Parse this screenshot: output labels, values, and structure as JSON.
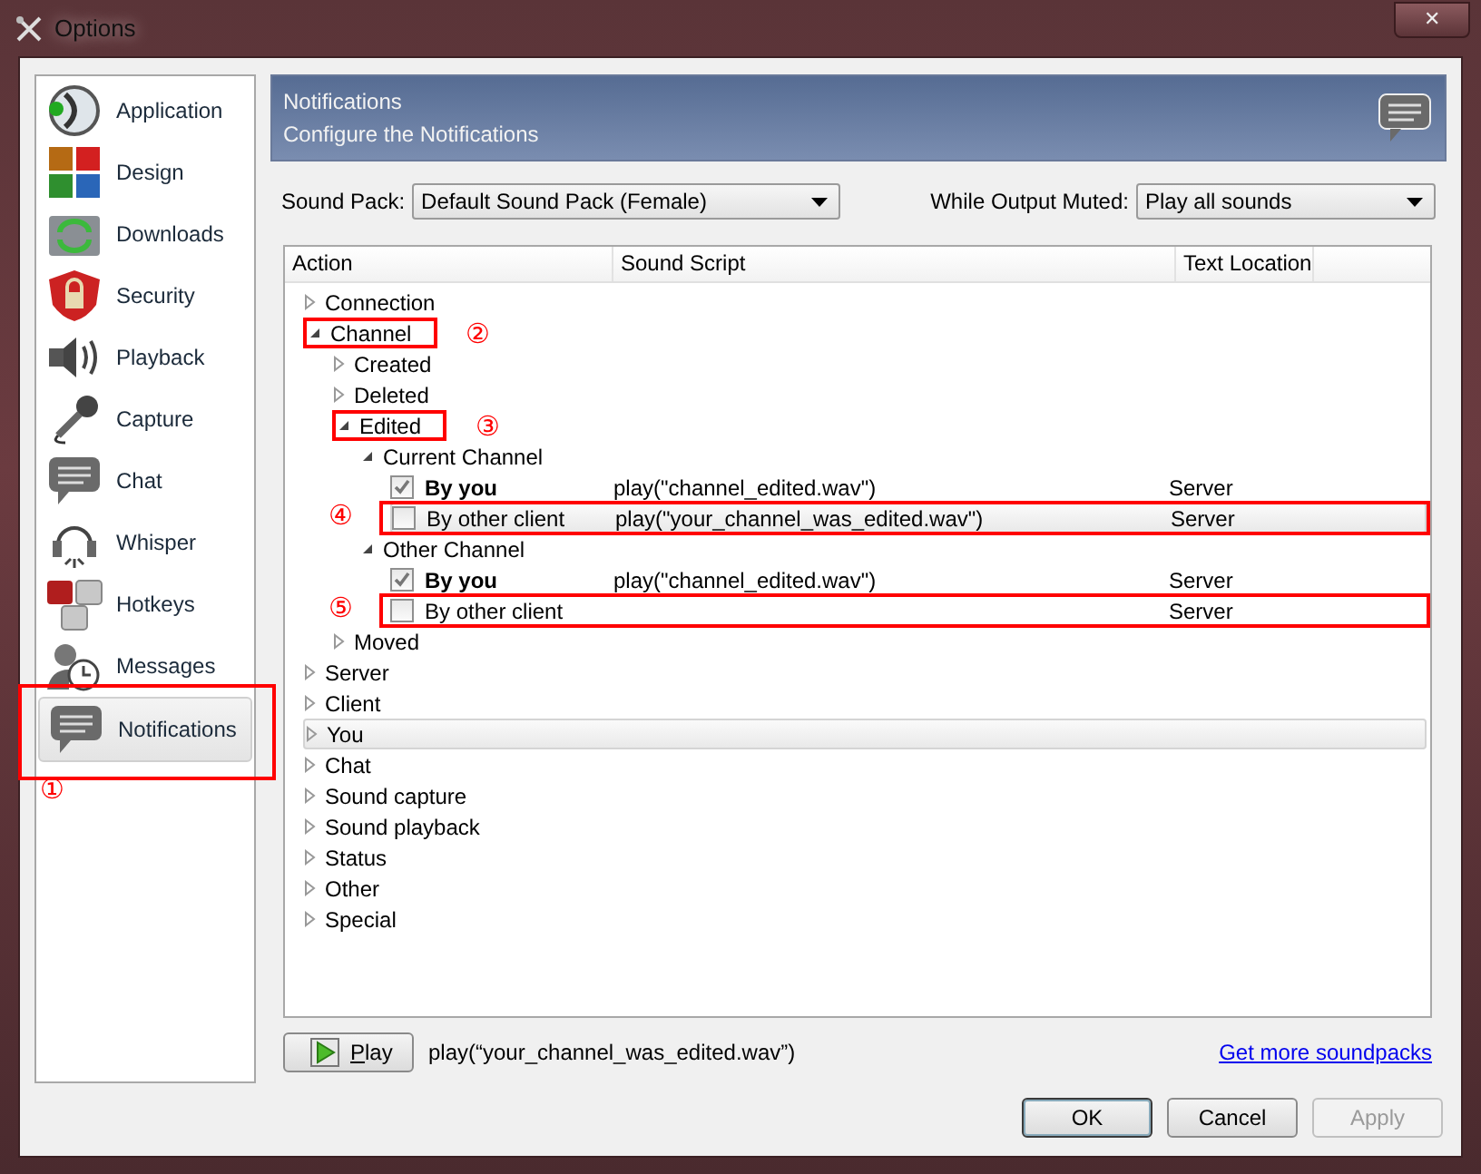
{
  "window": {
    "title": "Options",
    "close": "✕"
  },
  "sidebar": {
    "items": [
      {
        "label": "Application",
        "selected": false
      },
      {
        "label": "Design",
        "selected": false
      },
      {
        "label": "Downloads",
        "selected": false
      },
      {
        "label": "Security",
        "selected": false
      },
      {
        "label": "Playback",
        "selected": false
      },
      {
        "label": "Capture",
        "selected": false
      },
      {
        "label": "Chat",
        "selected": false
      },
      {
        "label": "Whisper",
        "selected": false
      },
      {
        "label": "Hotkeys",
        "selected": false
      },
      {
        "label": "Messages",
        "selected": false
      },
      {
        "label": "Notifications",
        "selected": true,
        "annotation": {
          "kind": "item",
          "number": "①"
        }
      }
    ]
  },
  "header": {
    "title": "Notifications",
    "subtitle": "Configure the Notifications"
  },
  "sound_pack": {
    "label": "Sound Pack:",
    "value": "Default Sound Pack (Female)"
  },
  "output_muted": {
    "label": "While Output Muted:",
    "value": "Play all sounds"
  },
  "table": {
    "columns": [
      "Action",
      "Sound Script",
      "Text Location"
    ],
    "rows": [
      {
        "kind": "group",
        "label": "Connection",
        "expanded": false,
        "selected": false
      },
      {
        "kind": "group",
        "label": "Channel",
        "expanded": true,
        "selected": false,
        "annotation": {
          "kind": "label",
          "number": "②"
        },
        "children": [
          {
            "kind": "group",
            "label": "Created",
            "expanded": false,
            "selected": false
          },
          {
            "kind": "group",
            "label": "Deleted",
            "expanded": false,
            "selected": false
          },
          {
            "kind": "group",
            "label": "Edited",
            "expanded": true,
            "selected": false,
            "annotation": {
              "kind": "label",
              "number": "③"
            },
            "children": [
              {
                "kind": "group",
                "label": "Current Channel",
                "expanded": true,
                "selected": false,
                "children": [
                  {
                    "kind": "check",
                    "label": "By you",
                    "bold": true,
                    "checked": true,
                    "script": "play(\"channel_edited.wav\")",
                    "location": "Server",
                    "selected": false
                  },
                  {
                    "kind": "check",
                    "label": "By other client",
                    "bold": false,
                    "checked": false,
                    "script": "play(\"your_channel_was_edited.wav\")",
                    "location": "Server",
                    "selected": true,
                    "annotation": {
                      "kind": "row",
                      "number": "④"
                    }
                  }
                ]
              },
              {
                "kind": "group",
                "label": "Other Channel",
                "expanded": true,
                "selected": false,
                "children": [
                  {
                    "kind": "check",
                    "label": "By you",
                    "bold": true,
                    "checked": true,
                    "script": "play(\"channel_edited.wav\")",
                    "location": "Server",
                    "selected": false
                  },
                  {
                    "kind": "check",
                    "label": "By other client",
                    "bold": false,
                    "checked": false,
                    "location": "Server",
                    "selected": false,
                    "annotation": {
                      "kind": "row",
                      "number": "⑤"
                    }
                  }
                ]
              }
            ]
          },
          {
            "kind": "group",
            "label": "Moved",
            "expanded": false,
            "selected": false
          }
        ]
      },
      {
        "kind": "group",
        "label": "Server",
        "expanded": false,
        "selected": false
      },
      {
        "kind": "group",
        "label": "Client",
        "expanded": false,
        "selected": false
      },
      {
        "kind": "group",
        "label": "You",
        "expanded": false,
        "selected": true
      },
      {
        "kind": "group",
        "label": "Chat",
        "expanded": false,
        "selected": false
      },
      {
        "kind": "group",
        "label": "Sound capture",
        "expanded": false,
        "selected": false
      },
      {
        "kind": "group",
        "label": "Sound playback",
        "expanded": false,
        "selected": false
      },
      {
        "kind": "group",
        "label": "Status",
        "expanded": false,
        "selected": false
      },
      {
        "kind": "group",
        "label": "Other",
        "expanded": false,
        "selected": false
      },
      {
        "kind": "group",
        "label": "Special",
        "expanded": false,
        "selected": false
      }
    ]
  },
  "play_button": "Play",
  "current_script": "play(“your_channel_was_edited.wav”)",
  "link": "Get more soundpacks",
  "buttons": [
    {
      "label": "OK",
      "disabled": false,
      "default": true
    },
    {
      "label": "Cancel",
      "disabled": false,
      "default": false
    },
    {
      "label": "Apply",
      "disabled": true,
      "default": false
    }
  ]
}
